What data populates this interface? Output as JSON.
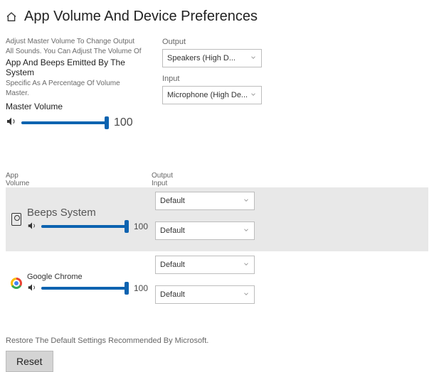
{
  "header": {
    "title": "App Volume And Device Preferences"
  },
  "master": {
    "desc1": "Adjust Master Volume To Change Output",
    "desc2": "All Sounds. You Can Adjust The Volume Of",
    "desc3": "App And Beeps Emitted By The System",
    "desc4": "Specific As A Percentage Of Volume",
    "desc5": "Master.",
    "label": "Master Volume",
    "value": "100"
  },
  "device": {
    "output_label": "Output",
    "output_value": "Speakers (High D...",
    "input_label": "Input",
    "input_value": "Microphone (High De..."
  },
  "app_header": {
    "left1": "App",
    "left2": "Volume",
    "right1": "Output",
    "right2": "Input"
  },
  "apps": [
    {
      "name": "Beeps System",
      "value": "100",
      "output": "Default",
      "input": "Default"
    },
    {
      "name": "Google Chrome",
      "value": "100",
      "output": "Default",
      "input": "Default"
    }
  ],
  "restore": {
    "text": "Restore The Default Settings Recommended By Microsoft.",
    "button": "Reset"
  }
}
